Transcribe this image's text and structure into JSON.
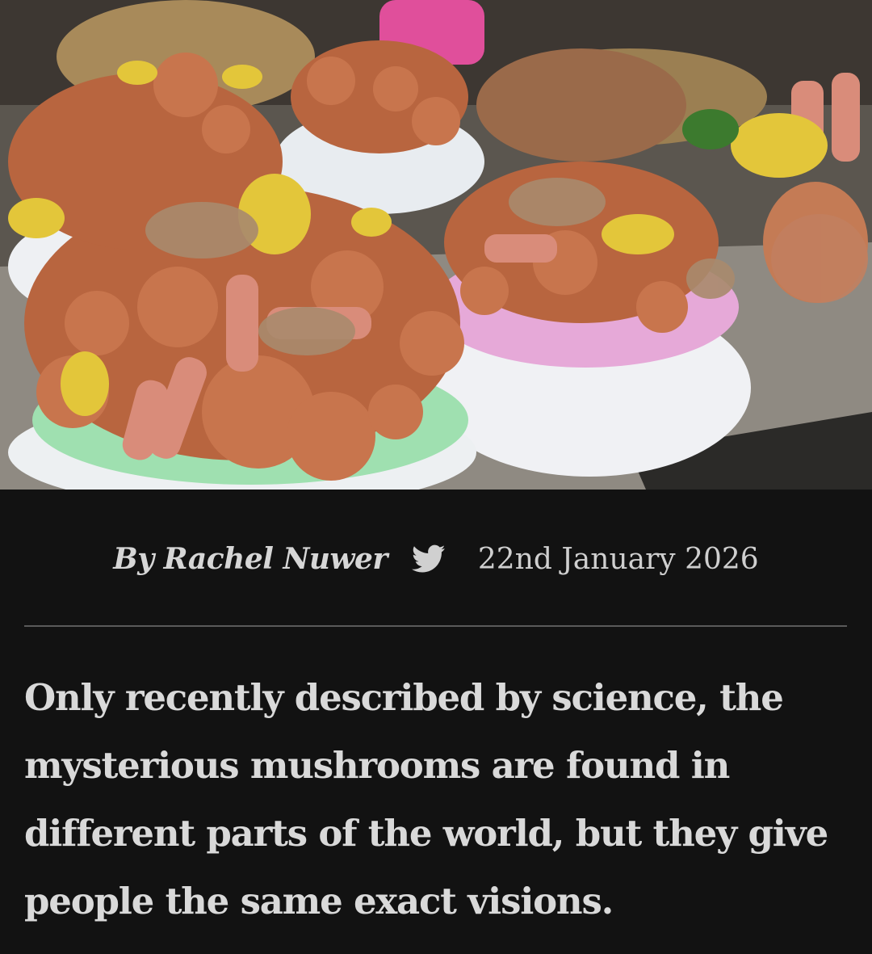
{
  "article": {
    "byline": "By Rachel Nuwer",
    "date": "22nd January 2026",
    "summary": "Only recently described by science, the mysterious mushrooms are found in different parts of the world, but they give people the same exact visions."
  },
  "hero_image": {
    "description_icon": "mushroom-market-photo"
  },
  "colors": {
    "background": "#121212",
    "text": "#d9d9d9",
    "divider": "#5a5a5a"
  }
}
